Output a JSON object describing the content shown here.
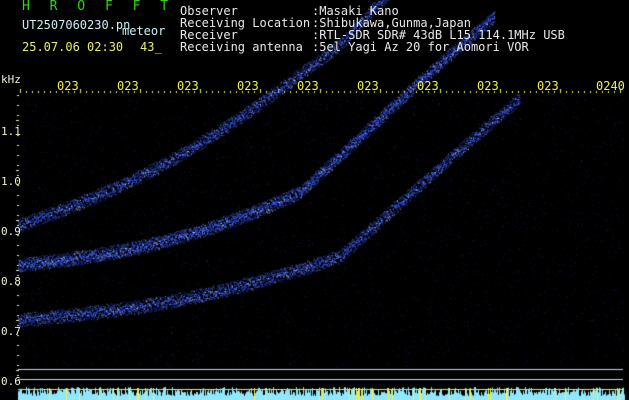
{
  "header": {
    "app_title": "H R O F F T",
    "file_name": "UT2507060230.pn",
    "meteor_label": "meteor",
    "timestamp": "25.07.06 02:30",
    "count": "43_"
  },
  "station_info": {
    "labels": [
      "Observer",
      "Receiving Location",
      "Receiver",
      "Receiving antenna"
    ],
    "values": [
      ":Masaki Kano",
      ":Shibukawa,Gunma,Japan",
      ":RTL-SDR SDR# 43dB L15 114.1MHz USB",
      ":5el Yagi Az 20 for Aomori VOR"
    ]
  },
  "spectrogram": {
    "y_unit": "kHz",
    "y_ticks": [
      "1.1",
      "1.0",
      "0.9",
      "0.8",
      "0.7",
      "0.6"
    ],
    "y_tick_values": [
      1.1,
      1.0,
      0.9,
      0.8,
      0.7,
      0.6
    ],
    "x_ticks": [
      "023",
      "023",
      "023",
      "023",
      "023",
      "023",
      "023",
      "023",
      "023",
      "0240"
    ],
    "colors": {
      "background": "#000000",
      "signal": "#3b5cff",
      "signal_bright": "#c8d4ff",
      "grid": "#f0f050",
      "baseline": "#8fe8ff"
    }
  }
}
